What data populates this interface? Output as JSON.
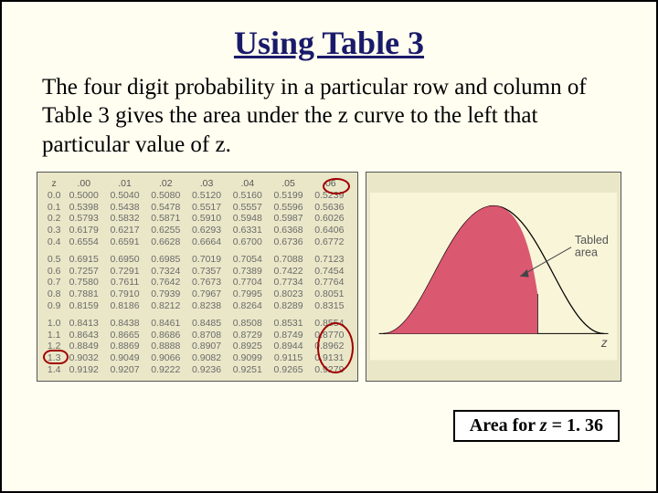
{
  "title": "Using Table 3",
  "body_text": "The four digit probability in a particular row and column of Table 3 gives the area under the z curve to the left that particular value of z.",
  "table": {
    "z_header": "z",
    "cols": [
      ".00",
      ".01",
      ".02",
      ".03",
      ".04",
      ".05",
      ".06"
    ],
    "rows": [
      {
        "z": "0.0",
        "v": [
          "0.5000",
          "0.5040",
          "0.5080",
          "0.5120",
          "0.5160",
          "0.5199",
          "0.5239"
        ]
      },
      {
        "z": "0.1",
        "v": [
          "0.5398",
          "0.5438",
          "0.5478",
          "0.5517",
          "0.5557",
          "0.5596",
          "0.5636"
        ]
      },
      {
        "z": "0.2",
        "v": [
          "0.5793",
          "0.5832",
          "0.5871",
          "0.5910",
          "0.5948",
          "0.5987",
          "0.6026"
        ]
      },
      {
        "z": "0.3",
        "v": [
          "0.6179",
          "0.6217",
          "0.6255",
          "0.6293",
          "0.6331",
          "0.6368",
          "0.6406"
        ]
      },
      {
        "z": "0.4",
        "v": [
          "0.6554",
          "0.6591",
          "0.6628",
          "0.6664",
          "0.6700",
          "0.6736",
          "0.6772"
        ]
      },
      {
        "z": "0.5",
        "v": [
          "0.6915",
          "0.6950",
          "0.6985",
          "0.7019",
          "0.7054",
          "0.7088",
          "0.7123"
        ]
      },
      {
        "z": "0.6",
        "v": [
          "0.7257",
          "0.7291",
          "0.7324",
          "0.7357",
          "0.7389",
          "0.7422",
          "0.7454"
        ]
      },
      {
        "z": "0.7",
        "v": [
          "0.7580",
          "0.7611",
          "0.7642",
          "0.7673",
          "0.7704",
          "0.7734",
          "0.7764"
        ]
      },
      {
        "z": "0.8",
        "v": [
          "0.7881",
          "0.7910",
          "0.7939",
          "0.7967",
          "0.7995",
          "0.8023",
          "0.8051"
        ]
      },
      {
        "z": "0.9",
        "v": [
          "0.8159",
          "0.8186",
          "0.8212",
          "0.8238",
          "0.8264",
          "0.8289",
          "0.8315"
        ]
      },
      {
        "z": "1.0",
        "v": [
          "0.8413",
          "0.8438",
          "0.8461",
          "0.8485",
          "0.8508",
          "0.8531",
          "0.8554"
        ]
      },
      {
        "z": "1.1",
        "v": [
          "0.8643",
          "0.8665",
          "0.8686",
          "0.8708",
          "0.8729",
          "0.8749",
          "0.8770"
        ]
      },
      {
        "z": "1.2",
        "v": [
          "0.8849",
          "0.8869",
          "0.8888",
          "0.8907",
          "0.8925",
          "0.8944",
          "0.8962"
        ]
      },
      {
        "z": "1.3",
        "v": [
          "0.9032",
          "0.9049",
          "0.9066",
          "0.9082",
          "0.9099",
          "0.9115",
          "0.9131"
        ]
      },
      {
        "z": "1.4",
        "v": [
          "0.9192",
          "0.9207",
          "0.9222",
          "0.9236",
          "0.9251",
          "0.9265",
          "0.9279"
        ]
      }
    ]
  },
  "curve": {
    "tabled_area_label": "Tabled area",
    "axis_label": "z"
  },
  "caption": {
    "prefix": "Area for ",
    "var": "z",
    "suffix": " = 1. 36"
  },
  "highlight": {
    "row_z": "1.3",
    "col": ".06",
    "value": "0.9131"
  }
}
